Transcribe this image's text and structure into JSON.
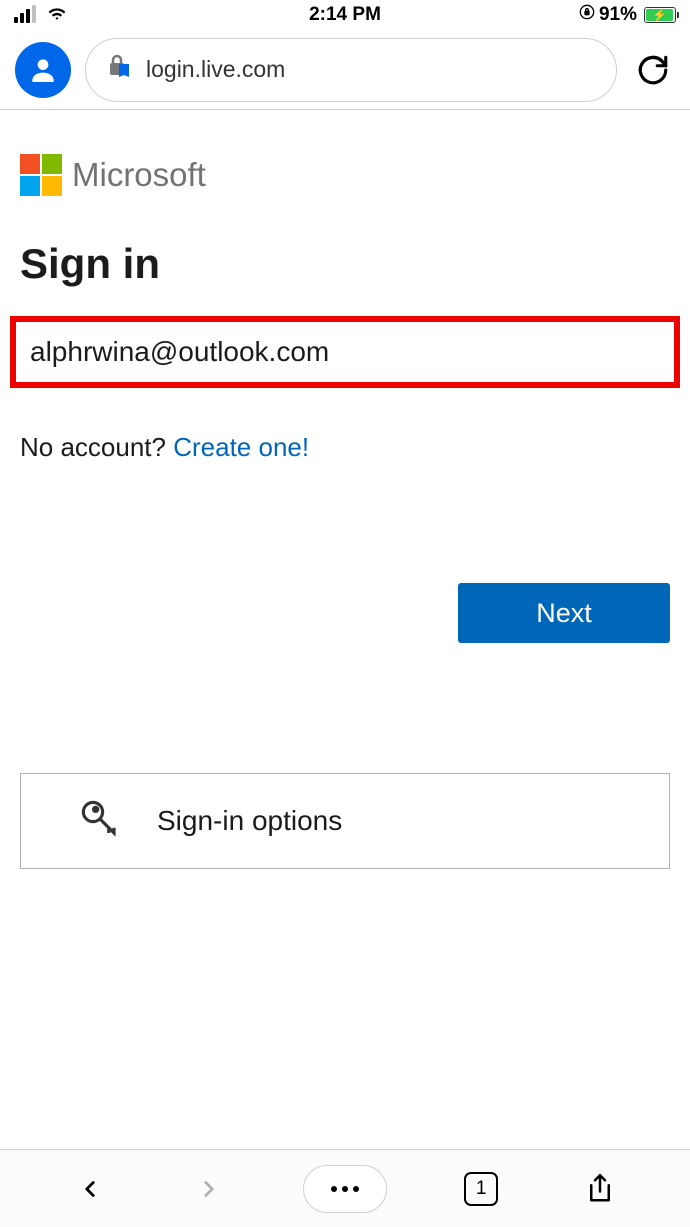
{
  "status_bar": {
    "time": "2:14 PM",
    "battery_percent": "91%"
  },
  "address_bar": {
    "url": "login.live.com"
  },
  "page": {
    "brand": "Microsoft",
    "heading": "Sign in",
    "email_value": "alphrwina@outlook.com",
    "no_account_text": "No account? ",
    "create_link": "Create one!",
    "next_button": "Next",
    "signin_options": "Sign-in options"
  },
  "toolbar": {
    "tabs_count": "1"
  }
}
